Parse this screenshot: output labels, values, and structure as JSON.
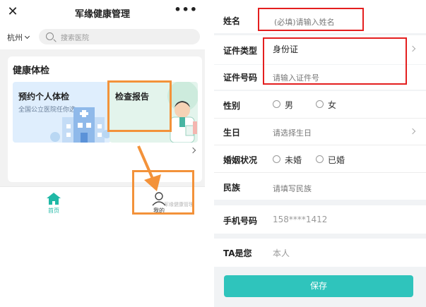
{
  "app": {
    "title": "军缘健康管理",
    "close_glyph": "✕",
    "more_glyph": "•••"
  },
  "search": {
    "city": "杭州",
    "placeholder": "搜索医院"
  },
  "checkup": {
    "section_title": "健康体检",
    "personal_title": "预约个人体检",
    "personal_subtitle": "全国公立医院任你选",
    "report_title": "检查报告"
  },
  "nav": {
    "home_label": "首页",
    "mine_label": "我的",
    "watermark": "军缘健康管理"
  },
  "form": {
    "name_label": "姓名",
    "name_placeholder": "(必填)请输入姓名",
    "id_type_label": "证件类型",
    "id_type_value": "身份证",
    "id_number_label": "证件号码",
    "id_number_placeholder": "请输入证件号",
    "gender_label": "性别",
    "gender_male": "男",
    "gender_female": "女",
    "birthday_label": "生日",
    "birthday_placeholder": "请选择生日",
    "marital_label": "婚姻状况",
    "marital_unmarried": "未婚",
    "marital_married": "已婚",
    "ethnicity_label": "民族",
    "ethnicity_placeholder": "请填写民族",
    "phone_label": "手机号码",
    "phone_value": "158****1412",
    "relation_label": "TA是您",
    "relation_value": "本人",
    "save_label": "保存"
  },
  "colors": {
    "accent": "#2fc4bc",
    "annotation_orange": "#f3923a",
    "annotation_red": "#e41f1f"
  }
}
